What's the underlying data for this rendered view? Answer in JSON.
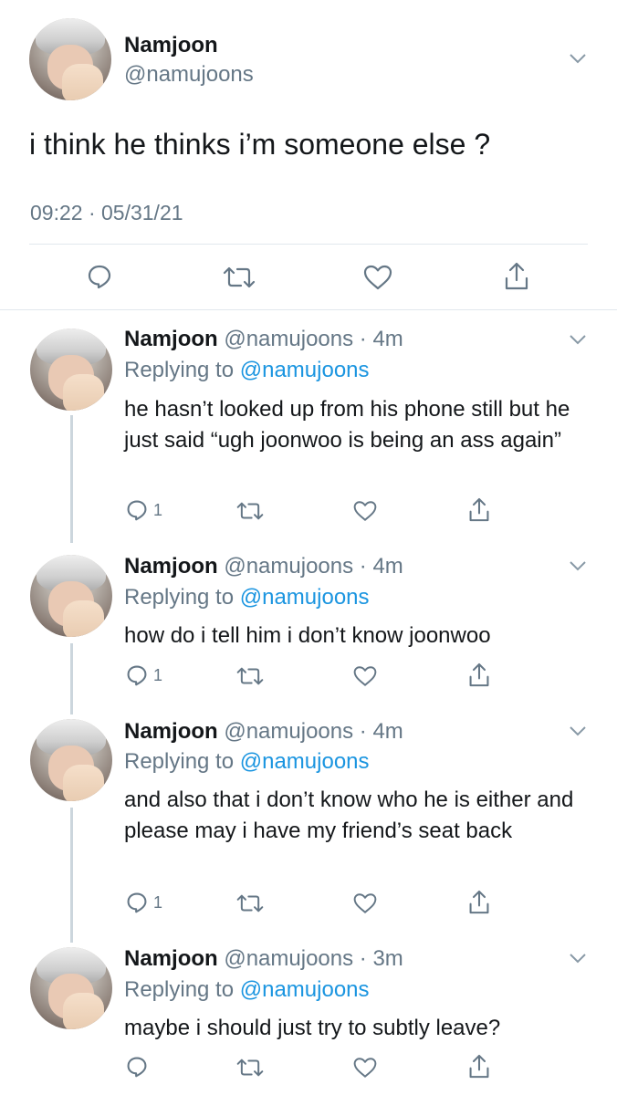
{
  "main_tweet": {
    "name": "Namjoon",
    "handle": "@namujoons",
    "text": "i think he thinks i’m someone else ?",
    "timestamp": "09:22 · 05/31/21"
  },
  "colors": {
    "secondary_text": "#657786",
    "mention": "#1b95e0",
    "divider": "#e1e8ed",
    "thread_line": "#ccd6dd"
  },
  "icons": [
    "reply-icon",
    "retweet-icon",
    "like-icon",
    "share-icon",
    "chevron-down-icon"
  ],
  "replies": [
    {
      "name": "Namjoon",
      "meta": "@namujoons · 4m",
      "replying_prefix": "Replying to",
      "replying_to": "@namujoons",
      "text": "he hasn’t looked up from his phone still but he just said “ugh joonwoo is being an ass again”",
      "reply_count": "1"
    },
    {
      "name": "Namjoon",
      "meta": "@namujoons · 4m",
      "replying_prefix": "Replying to",
      "replying_to": "@namujoons",
      "text": "how do i tell him i don’t know joonwoo",
      "reply_count": "1"
    },
    {
      "name": "Namjoon",
      "meta": "@namujoons · 4m",
      "replying_prefix": "Replying to",
      "replying_to": "@namujoons",
      "text": "and also that i don’t know who he is either and please may i have my friend’s seat back",
      "reply_count": "1"
    },
    {
      "name": "Namjoon",
      "meta": "@namujoons · 3m",
      "replying_prefix": "Replying to",
      "replying_to": "@namujoons",
      "text": "maybe i should just try to subtly leave?",
      "reply_count": ""
    }
  ]
}
